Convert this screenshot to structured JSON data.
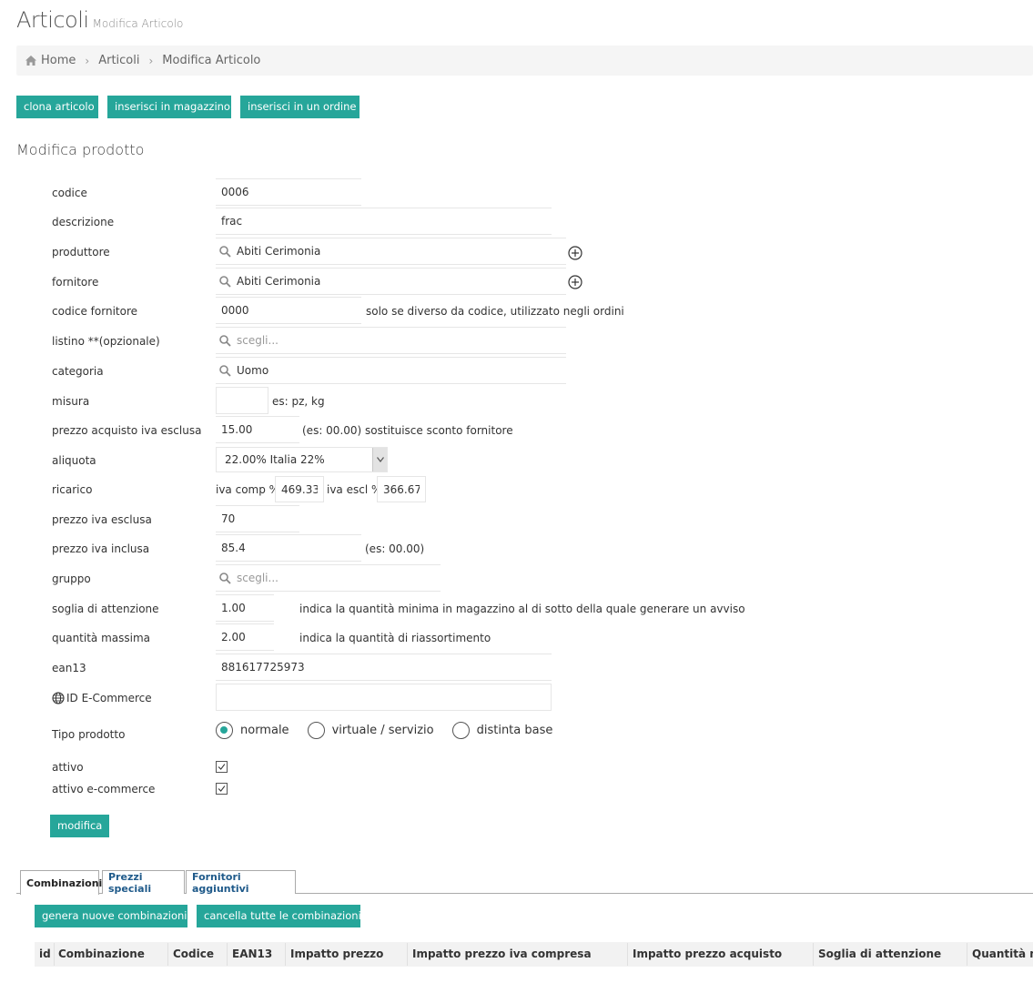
{
  "header": {
    "title": "Articoli",
    "subtitle": "Modifica Articolo"
  },
  "breadcrumb": {
    "home": "Home",
    "items": [
      "Articoli",
      "Modifica Articolo"
    ],
    "separator": "›"
  },
  "actions": {
    "clone": "clona articolo",
    "warehouse": "inserisci in magazzino",
    "order": "inserisci in un ordine"
  },
  "section_title": "Modifica prodotto",
  "form": {
    "codice": {
      "label": "codice",
      "value": "0006"
    },
    "descrizione": {
      "label": "descrizione",
      "value": "frac"
    },
    "produttore": {
      "label": "produttore",
      "value": "Abiti Cerimonia"
    },
    "fornitore": {
      "label": "fornitore",
      "value": "Abiti Cerimonia"
    },
    "codice_fornitore": {
      "label": "codice fornitore",
      "value": "0000",
      "hint": "solo se diverso da codice, utilizzato negli ordini"
    },
    "listino": {
      "label": "listino **(opzionale)",
      "placeholder": "scegli..."
    },
    "categoria": {
      "label": "categoria",
      "value": "Uomo"
    },
    "misura": {
      "label": "misura",
      "value": "",
      "hint": "es: pz, kg"
    },
    "prezzo_acquisto": {
      "label": "prezzo acquisto iva esclusa",
      "value": "15.00",
      "hint": "(es: 00.00) sostituisce sconto fornitore"
    },
    "aliquota": {
      "label": "aliquota",
      "value": "22.00% Italia 22%"
    },
    "ricarico": {
      "label": "ricarico",
      "comp_label": "iva comp %",
      "comp_value": "469.33",
      "escl_label": "iva escl %",
      "escl_value": "366.67"
    },
    "prezzo_iva_esclusa": {
      "label": "prezzo iva esclusa",
      "value": "70"
    },
    "prezzo_iva_inclusa": {
      "label": "prezzo iva inclusa",
      "value": "85.4",
      "hint": "(es: 00.00)"
    },
    "gruppo": {
      "label": "gruppo",
      "placeholder": "scegli..."
    },
    "soglia": {
      "label": "soglia di attenzione",
      "value": "1.00",
      "hint": "indica la quantità minima in magazzino al di sotto della quale generare un avviso"
    },
    "quantita_massima": {
      "label": "quantità massima",
      "value": "2.00",
      "hint": "indica la quantità di riassortimento"
    },
    "ean13": {
      "label": "ean13",
      "value": "881617725973"
    },
    "id_ecommerce": {
      "label": "ID E-Commerce",
      "value": ""
    },
    "tipo_prodotto": {
      "label": "Tipo prodotto",
      "options": [
        "normale",
        "virtuale / servizio",
        "distinta base"
      ],
      "selected": "normale"
    },
    "attivo": {
      "label": "attivo",
      "checked": true
    },
    "attivo_ecommerce": {
      "label": "attivo e-commerce",
      "checked": true
    },
    "submit": "modifica"
  },
  "tabs": [
    "Combinazioni",
    "Prezzi speciali",
    "Fornitori aggiuntivi"
  ],
  "combinations": {
    "generate": "genera nuove combinazioni",
    "delete_all": "cancella tutte le combinazioni",
    "columns": [
      "id",
      "Combinazione",
      "Codice",
      "EAN13",
      "Impatto prezzo",
      "Impatto prezzo iva compresa",
      "Impatto prezzo acquisto",
      "Soglia di attenzione",
      "Quantità m"
    ]
  },
  "colors": {
    "accent": "#26a69a",
    "tab_link": "#1f5a8a"
  }
}
